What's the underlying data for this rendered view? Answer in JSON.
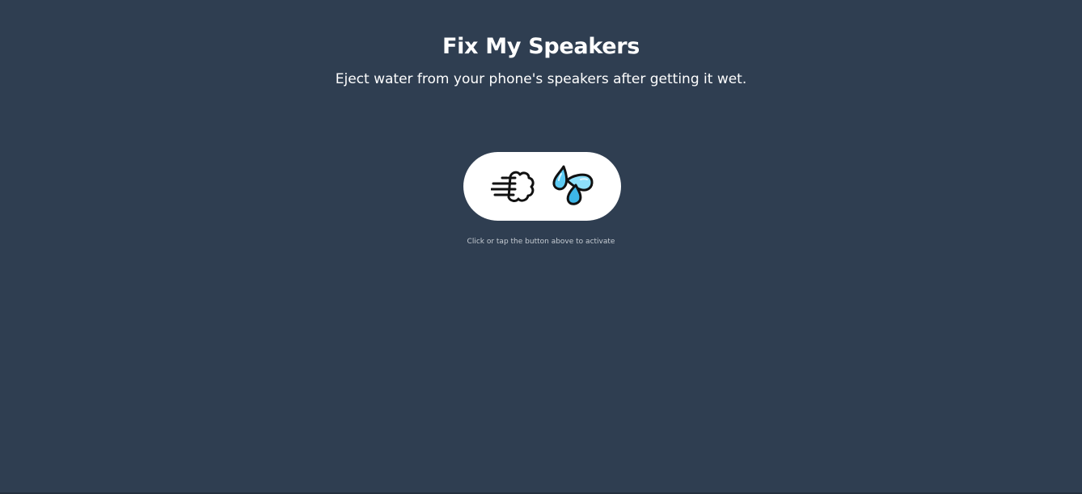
{
  "header": {
    "title": "Fix My Speakers",
    "subtitle": "Eject water from your phone's speakers after getting it wet."
  },
  "eject_button": {
    "icons": [
      "dashing-away-icon",
      "sweat-droplets-icon"
    ],
    "aria_label": "Eject water"
  },
  "hint": {
    "text": "Click or tap the button above to activate"
  },
  "colors": {
    "background": "#2f3e51",
    "button": "#ffffff",
    "text": "#ffffff",
    "hint_text": "#c6ccd3",
    "drop_blue": "#5ecbf3"
  }
}
